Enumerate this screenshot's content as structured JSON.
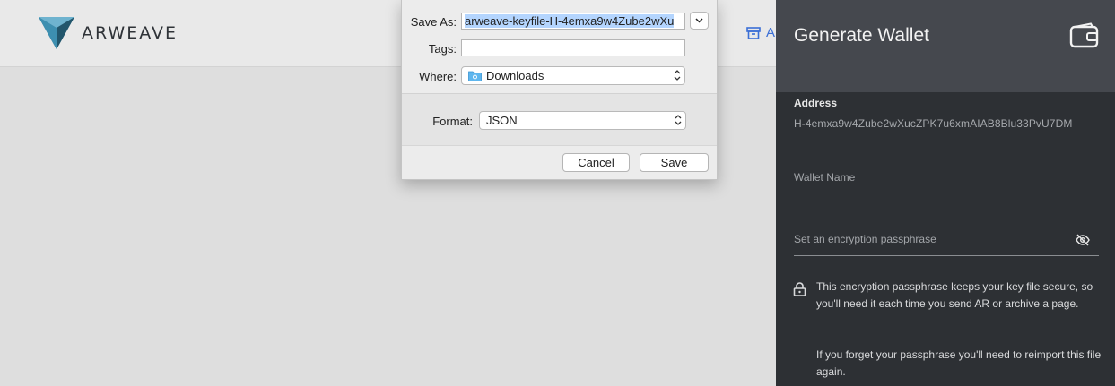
{
  "header": {
    "logo_text": "ARWEAVE",
    "action_label": "A"
  },
  "save_dialog": {
    "save_as_label": "Save As:",
    "filename_value": "arweave-keyfile-H-4emxa9w4Zube2wXu",
    "tags_label": "Tags:",
    "tags_value": "",
    "where_label": "Where:",
    "where_value": "Downloads",
    "format_label": "Format:",
    "format_value": "JSON",
    "cancel_label": "Cancel",
    "save_label": "Save"
  },
  "panel": {
    "title": "Generate Wallet",
    "address_label": "Address",
    "address_value": "H-4emxa9w4Zube2wXucZPK7u6xmAIAB8Blu33PvU7DM",
    "wallet_name_placeholder": "Wallet Name",
    "passphrase_placeholder": "Set an encryption passphrase",
    "info_line1": "This encryption passphrase keeps your key file secure, so you'll need it each time you send AR or archive a page.",
    "info_line2": "If you forget your passphrase you'll need to reimport this file again."
  },
  "colors": {
    "panel_bg": "#2d3034",
    "panel_header_bg": "#45484e",
    "accent_blue": "#3b6fd6",
    "app_bg": "#dedede"
  },
  "icons": [
    "arweave-logo-icon",
    "archive-box-icon",
    "chevron-down-icon",
    "folder-icon",
    "updown-arrows-icon",
    "wallet-icon",
    "eye-off-icon",
    "lock-icon"
  ]
}
